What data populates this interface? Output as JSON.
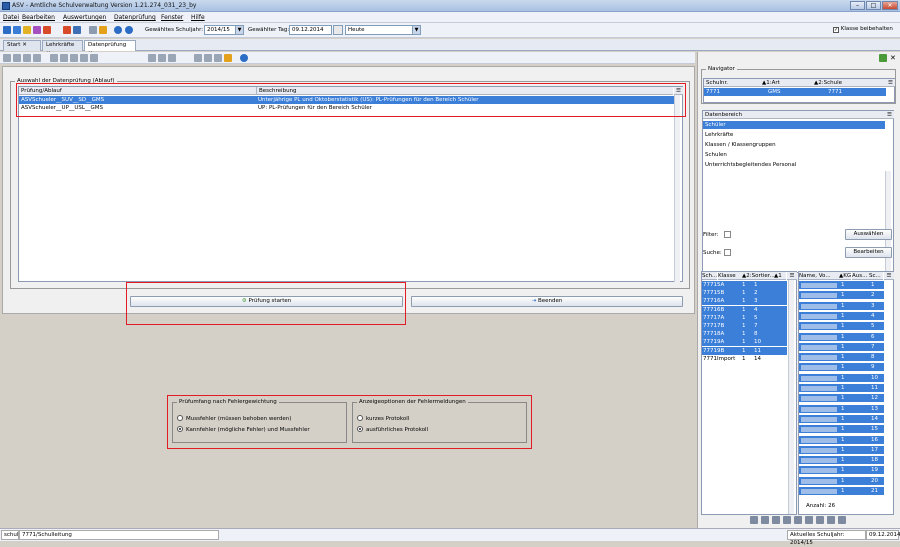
{
  "window": {
    "title": "ASV - Amtliche Schulverwaltung Version 1.21.274_031_23_by"
  },
  "menu": [
    "Datei",
    "Bearbeiten",
    "Auswertungen",
    "Datenprüfung",
    "Fenster",
    "Hilfe"
  ],
  "toolbar": {
    "schuljahr_label": "Gewähltes Schuljahr:",
    "schuljahr_value": "2014/15",
    "tag_label": "Gewählter Tag:",
    "tag_value": "09.12.2014",
    "heute_value": "Heute",
    "klasse_beibehalten": "Klasse beibehalten"
  },
  "tabs": [
    "Start",
    "Lehrkräfte",
    "Datenprüfung"
  ],
  "left": {
    "group_title": "Auswahl der Datenprüfung (Ablauf)",
    "col1": "Prüfung/Ablauf",
    "col2": "Beschreibung",
    "rows": [
      {
        "name": "ASVSchueler__SUV__SD__GMS",
        "desc": "Unterjährige PL und Oktoberstatistik (US): PL-Prüfungen für den Bereich Schüler"
      },
      {
        "name": "ASVSchueler__UP__USL__GMS",
        "desc": "UP: PL-Prüfungen für den Bereich Schüler"
      }
    ],
    "start_button": "Prüfung starten",
    "end_button": "Beenden"
  },
  "options": {
    "group1_title": "Prüfumfang nach Fehlergewichtung",
    "opt1a": "Mussfehler (müssen behoben werden)",
    "opt1b": "Kannfehler (mögliche Fehler) und Mussfehler",
    "group2_title": "Anzeigeoptionen der Fehlermeldungen",
    "opt2a": "kurzes Protokoll",
    "opt2b": "ausführliches Protokoll"
  },
  "navigator": {
    "title": "Navigator",
    "col1": "Schulnr.",
    "col2": "1:Art",
    "col3": "2:Schule",
    "row": {
      "nr": "7771",
      "art": "GMS",
      "schule": "7771"
    },
    "bereich_header": "Datenbereich",
    "bereiche": [
      "Schüler",
      "Lehrkräfte",
      "Klassen / Klassengruppen",
      "Schulen",
      "Unterrichtsbegleitendes Personal"
    ],
    "filter_label": "Filter:",
    "suche_label": "Suche:",
    "auswaehlen_button": "Auswählen",
    "bearbeiten_button": "Bearbeiten",
    "klassen_cols": [
      "Sch...",
      "Klasse",
      "2:Sortier...",
      "1"
    ],
    "klassen": [
      [
        "7771",
        "5A",
        "1",
        "1"
      ],
      [
        "7771",
        "5B",
        "1",
        "2"
      ],
      [
        "7771",
        "6A",
        "1",
        "3"
      ],
      [
        "7771",
        "6B",
        "1",
        "4"
      ],
      [
        "7771",
        "7A",
        "1",
        "5"
      ],
      [
        "7771",
        "7B",
        "1",
        "7"
      ],
      [
        "7771",
        "8A",
        "1",
        "8"
      ],
      [
        "7771",
        "9A",
        "1",
        "10"
      ],
      [
        "7771",
        "9B",
        "1",
        "11"
      ],
      [
        "7771",
        "Import",
        "1",
        "14"
      ]
    ],
    "schueler_cols": [
      "Name, Vo...",
      "KG",
      "Aus...",
      "Sc..."
    ],
    "schueler_nums": [
      "1",
      "2",
      "3",
      "4",
      "5",
      "6",
      "7",
      "8",
      "9",
      "10",
      "11",
      "12",
      "13",
      "14",
      "15",
      "16",
      "17",
      "18",
      "19",
      "20",
      "21"
    ],
    "anzahl": "Anzahl: 26"
  },
  "status": {
    "left1": "schul",
    "left2": "7771/Schulleitung",
    "right1": "Aktuelles Schuljahr: 2014/15",
    "right2": "09.12.2014"
  }
}
